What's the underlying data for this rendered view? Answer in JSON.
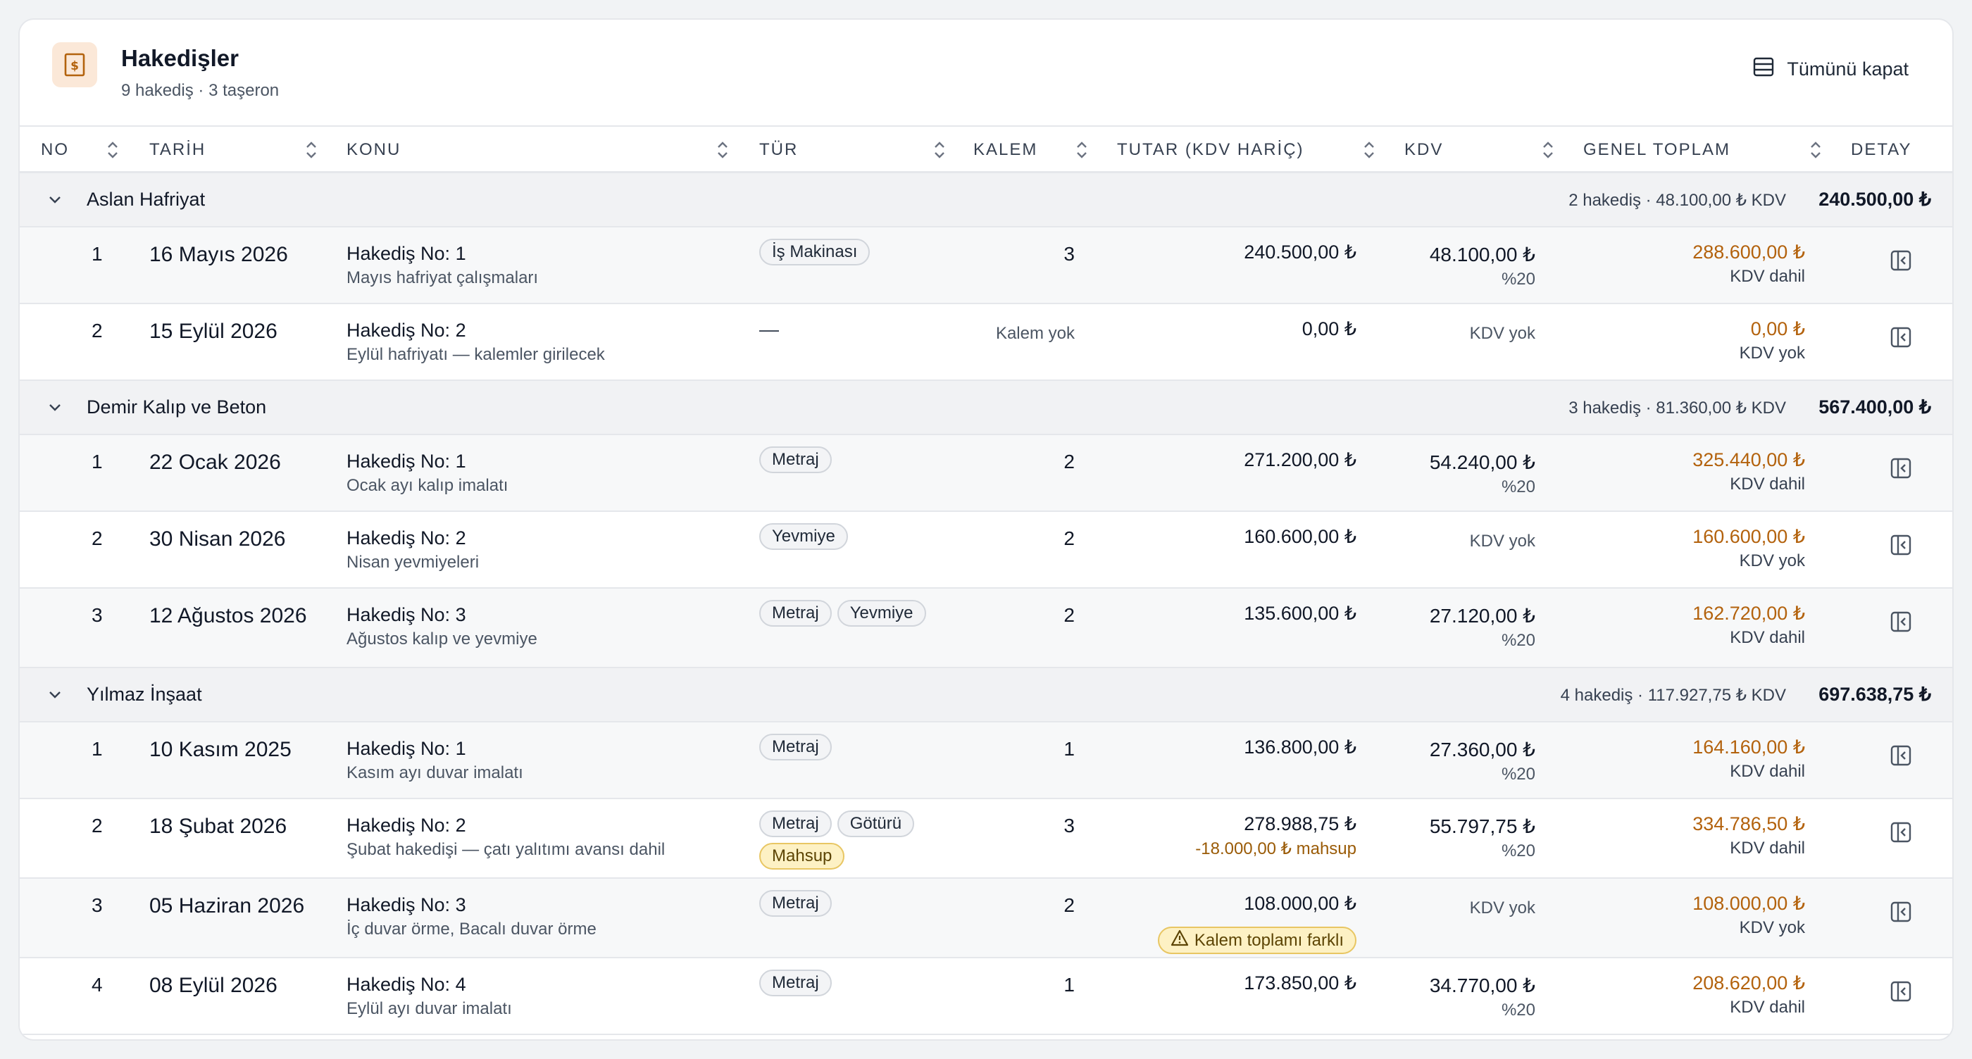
{
  "header": {
    "title": "Hakedişler",
    "subtitle": "9 hakediş · 3 taşeron",
    "collapse_label": "Tümünü kapat",
    "icon": "receipt-dollar-icon",
    "icon_bg": "#fbe8d8",
    "icon_color": "#b3620d"
  },
  "columns": [
    {
      "label": "NO",
      "sortable": true
    },
    {
      "label": "TARİH",
      "sortable": true
    },
    {
      "label": "KONU",
      "sortable": true
    },
    {
      "label": "TÜR",
      "sortable": true
    },
    {
      "label": "KALEM",
      "sortable": true
    },
    {
      "label": "TUTAR (KDV HARİÇ)",
      "sortable": true
    },
    {
      "label": "KDV",
      "sortable": true
    },
    {
      "label": "GENEL TOPLAM",
      "sortable": true
    },
    {
      "label": "DETAY",
      "sortable": false
    }
  ],
  "colors": {
    "accent_amount": "#b3620d",
    "warning_bg": "#fdf1c4",
    "warning_border": "#e8c663",
    "group_bg": "#f1f2f4"
  },
  "groups": [
    {
      "name": "Aslan Hafriyat",
      "meta": "2 hakediş · 48.100,00 ₺ KDV",
      "total": "240.500,00 ₺",
      "rows": [
        {
          "no": "1",
          "date": "16 Mayıs 2026",
          "title": "Hakediş No: 1",
          "desc": "Mayıs hafriyat çalışmaları",
          "tags": [
            "İş Makinası"
          ],
          "kalem": "3",
          "tutar": "240.500,00 ₺",
          "kdv": "48.100,00 ₺",
          "kdv_rate": "%20",
          "genel_toplam": "288.600,00 ₺",
          "gt_sub": "KDV dahil"
        },
        {
          "no": "2",
          "date": "15 Eylül 2026",
          "title": "Hakediş No: 2",
          "desc": "Eylül hafriyatı — kalemler girilecek",
          "tags": [],
          "no_tag": "—",
          "kalem": "Kalem yok",
          "tutar": "0,00 ₺",
          "kdv": "KDV yok",
          "genel_toplam": "0,00 ₺",
          "gt_sub": "KDV yok"
        }
      ]
    },
    {
      "name": "Demir Kalıp ve Beton",
      "meta": "3 hakediş · 81.360,00 ₺ KDV",
      "total": "567.400,00 ₺",
      "rows": [
        {
          "no": "1",
          "date": "22 Ocak 2026",
          "title": "Hakediş No: 1",
          "desc": "Ocak ayı kalıp imalatı",
          "tags": [
            "Metraj"
          ],
          "kalem": "2",
          "tutar": "271.200,00 ₺",
          "kdv": "54.240,00 ₺",
          "kdv_rate": "%20",
          "genel_toplam": "325.440,00 ₺",
          "gt_sub": "KDV dahil"
        },
        {
          "no": "2",
          "date": "30 Nisan 2026",
          "title": "Hakediş No: 2",
          "desc": "Nisan yevmiyeleri",
          "tags": [
            "Yevmiye"
          ],
          "kalem": "2",
          "tutar": "160.600,00 ₺",
          "kdv": "KDV yok",
          "genel_toplam": "160.600,00 ₺",
          "gt_sub": "KDV yok"
        },
        {
          "no": "3",
          "date": "12 Ağustos 2026",
          "title": "Hakediş No: 3",
          "desc": "Ağustos kalıp ve yevmiye",
          "tags": [
            "Metraj",
            "Yevmiye"
          ],
          "kalem": "2",
          "tutar": "135.600,00 ₺",
          "kdv": "27.120,00 ₺",
          "kdv_rate": "%20",
          "genel_toplam": "162.720,00 ₺",
          "gt_sub": "KDV dahil"
        }
      ]
    },
    {
      "name": "Yılmaz İnşaat",
      "meta": "4 hakediş · 117.927,75 ₺ KDV",
      "total": "697.638,75 ₺",
      "rows": [
        {
          "no": "1",
          "date": "10 Kasım 2025",
          "title": "Hakediş No: 1",
          "desc": "Kasım ayı duvar imalatı",
          "tags": [
            "Metraj"
          ],
          "kalem": "1",
          "tutar": "136.800,00 ₺",
          "kdv": "27.360,00 ₺",
          "kdv_rate": "%20",
          "genel_toplam": "164.160,00 ₺",
          "gt_sub": "KDV dahil"
        },
        {
          "no": "2",
          "date": "18 Şubat 2026",
          "title": "Hakediş No: 2",
          "desc": "Şubat hakedişi — çatı yalıtımı avansı dahil",
          "tags": [
            "Metraj",
            "Götürü"
          ],
          "warn_tags": [
            "Mahsup"
          ],
          "kalem": "3",
          "tutar": "278.988,75 ₺",
          "mahsup": "-18.000,00 ₺ mahsup",
          "kdv": "55.797,75 ₺",
          "kdv_rate": "%20",
          "genel_toplam": "334.786,50 ₺",
          "gt_sub": "KDV dahil"
        },
        {
          "no": "3",
          "date": "05 Haziran 2026",
          "title": "Hakediş No: 3",
          "desc": "İç duvar örme, Bacalı duvar örme",
          "tags": [
            "Metraj"
          ],
          "kalem": "2",
          "tutar": "108.000,00 ₺",
          "warning": "Kalem toplamı farklı",
          "kdv": "KDV yok",
          "genel_toplam": "108.000,00 ₺",
          "gt_sub": "KDV yok"
        },
        {
          "no": "4",
          "date": "08 Eylül 2026",
          "title": "Hakediş No: 4",
          "desc": "Eylül ayı duvar imalatı",
          "tags": [
            "Metraj"
          ],
          "kalem": "1",
          "tutar": "173.850,00 ₺",
          "kdv": "34.770,00 ₺",
          "kdv_rate": "%20",
          "genel_toplam": "208.620,00 ₺",
          "gt_sub": "KDV dahil"
        }
      ]
    }
  ]
}
